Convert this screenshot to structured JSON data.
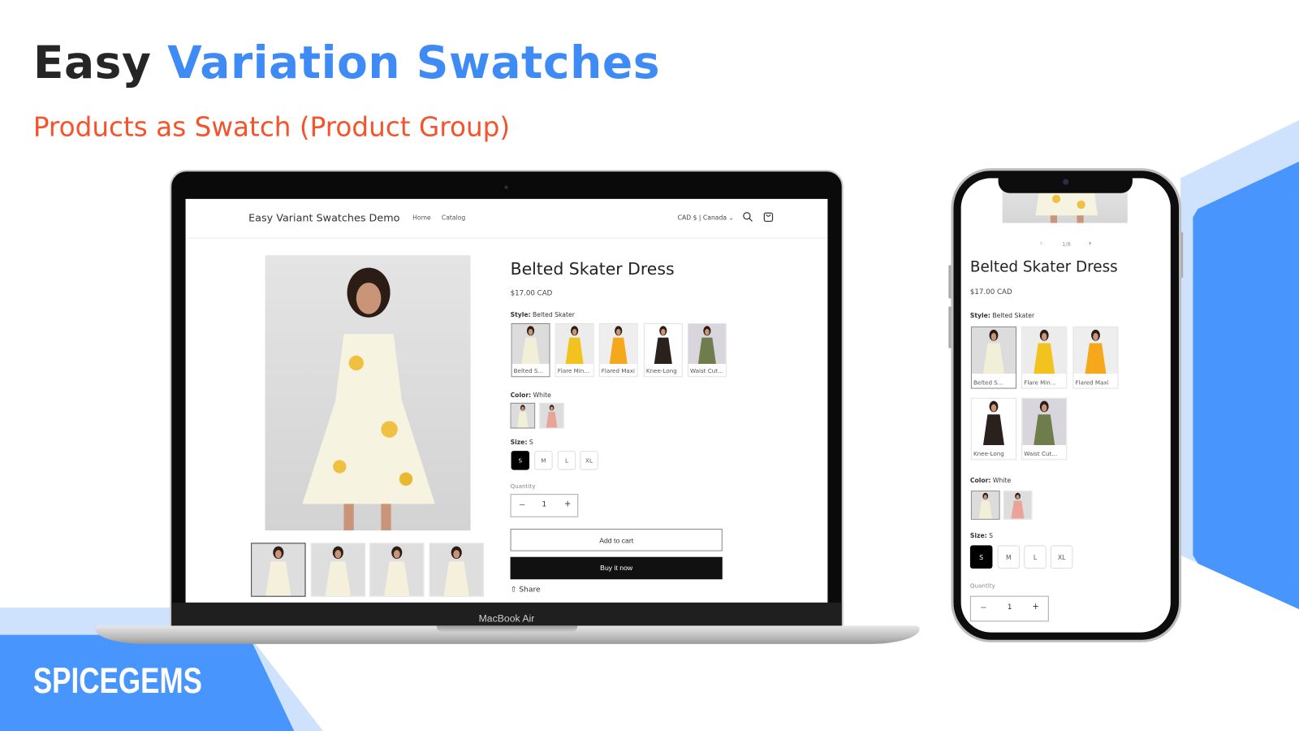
{
  "heading": {
    "part1": "Easy",
    "part2": "Variation Swatches",
    "subtitle": "Products as Swatch (Product Group)"
  },
  "brand": {
    "logo": "SPICEGEMS"
  },
  "colors": {
    "accent_blue": "#3e8bf5",
    "light_blue": "#cfe2fd",
    "orange": "#f4532b",
    "dark": "#262626"
  },
  "laptop": {
    "label": "MacBook Air",
    "store": {
      "name": "Easy Variant Swatches Demo",
      "nav": [
        "Home",
        "Catalog"
      ],
      "currency": "CAD $ | Canada",
      "icons": [
        "search-icon",
        "cart-icon"
      ]
    },
    "thumbnails": 4
  },
  "product": {
    "title": "Belted Skater Dress",
    "price": "$17.00 CAD",
    "style_label": "Style:",
    "style_value": "Belted Skater",
    "styles": [
      {
        "label": "Belted S...",
        "full": "Belted Skater",
        "bg": "#dcdcdc",
        "dress": "#f2efd8"
      },
      {
        "label": "Flare Min...",
        "full": "Flare Mini",
        "bg": "#ececec",
        "dress": "#f2c21f"
      },
      {
        "label": "Flared Maxi",
        "full": "Flared Maxi",
        "bg": "#eeeeee",
        "dress": "#f5a81c"
      },
      {
        "label": "Knee-Long",
        "full": "Knee-Long",
        "bg": "#ffffff",
        "dress": "#2a211c"
      },
      {
        "label": "Waist Cut...",
        "full": "Waist Cut",
        "bg": "#d8d6dc",
        "dress": "#6e7d4b"
      }
    ],
    "color_label": "Color:",
    "color_value": "White",
    "colors": [
      {
        "name": "White",
        "bg": "#dcdcdc",
        "dress": "#f2efd8"
      },
      {
        "name": "Pink",
        "bg": "#dddddd",
        "dress": "#e9a49a"
      }
    ],
    "size_label": "Size:",
    "size_value": "S",
    "sizes": [
      "S",
      "M",
      "L",
      "XL"
    ],
    "quantity_label": "Quantity",
    "quantity": "1",
    "minus": "−",
    "plus": "+",
    "add_to_cart": "Add to cart",
    "buy_now": "Buy it now",
    "share": "Share"
  },
  "phone": {
    "pager": "1/8",
    "prev": "‹",
    "next": "›"
  }
}
